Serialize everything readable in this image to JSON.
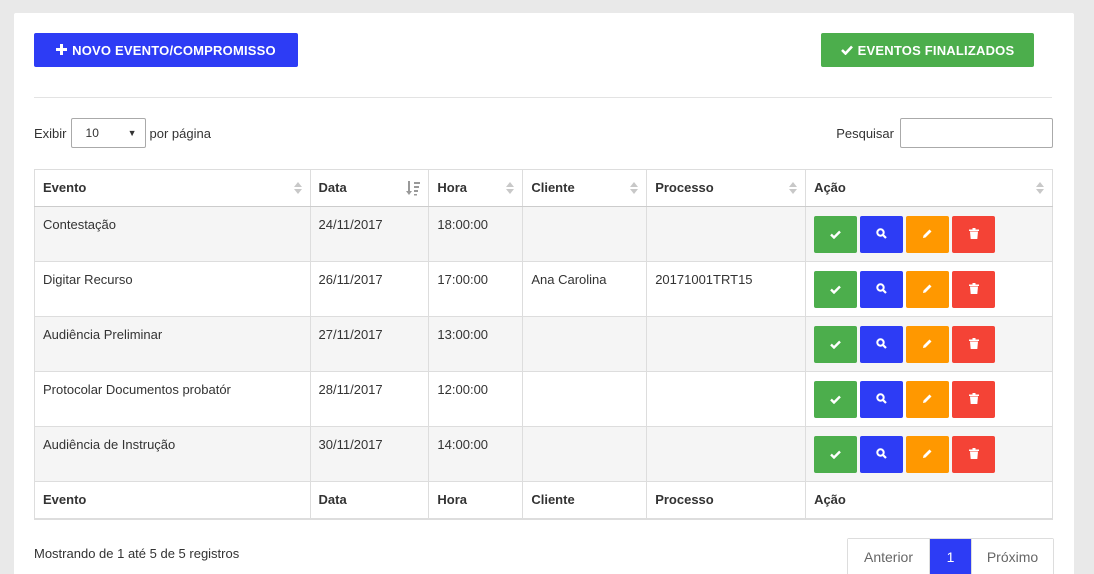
{
  "toolbar": {
    "new_event_label": "NOVO EVENTO/COMPROMISSO",
    "finished_events_label": "EVENTOS FINALIZADOS"
  },
  "length_menu": {
    "prefix": "Exibir",
    "selected": "10",
    "suffix": "por página"
  },
  "search": {
    "label": "Pesquisar",
    "value": ""
  },
  "table": {
    "headers": [
      "Evento",
      "Data",
      "Hora",
      "Cliente",
      "Processo",
      "Ação"
    ],
    "footers": [
      "Evento",
      "Data",
      "Hora",
      "Cliente",
      "Processo",
      "Ação"
    ],
    "rows": [
      {
        "evento": "Contestação",
        "data": "24/11/2017",
        "hora": "18:00:00",
        "cliente": "",
        "processo": ""
      },
      {
        "evento": "Digitar Recurso",
        "data": "26/11/2017",
        "hora": "17:00:00",
        "cliente": "Ana Carolina",
        "processo": "20171001TRT15"
      },
      {
        "evento": "Audiência Preliminar",
        "data": "27/11/2017",
        "hora": "13:00:00",
        "cliente": "",
        "processo": ""
      },
      {
        "evento": "Protocolar Documentos probatór",
        "data": "28/11/2017",
        "hora": "12:00:00",
        "cliente": "",
        "processo": ""
      },
      {
        "evento": "Audiência de Instrução",
        "data": "30/11/2017",
        "hora": "14:00:00",
        "cliente": "",
        "processo": ""
      }
    ]
  },
  "info": "Mostrando de 1 até 5 de 5 registros",
  "pagination": {
    "previous": "Anterior",
    "current": "1",
    "next": "Próximo"
  },
  "colors": {
    "primary": "#2d3cf5",
    "success": "#4cae4c",
    "warning": "#ff9800",
    "danger": "#f44336"
  }
}
